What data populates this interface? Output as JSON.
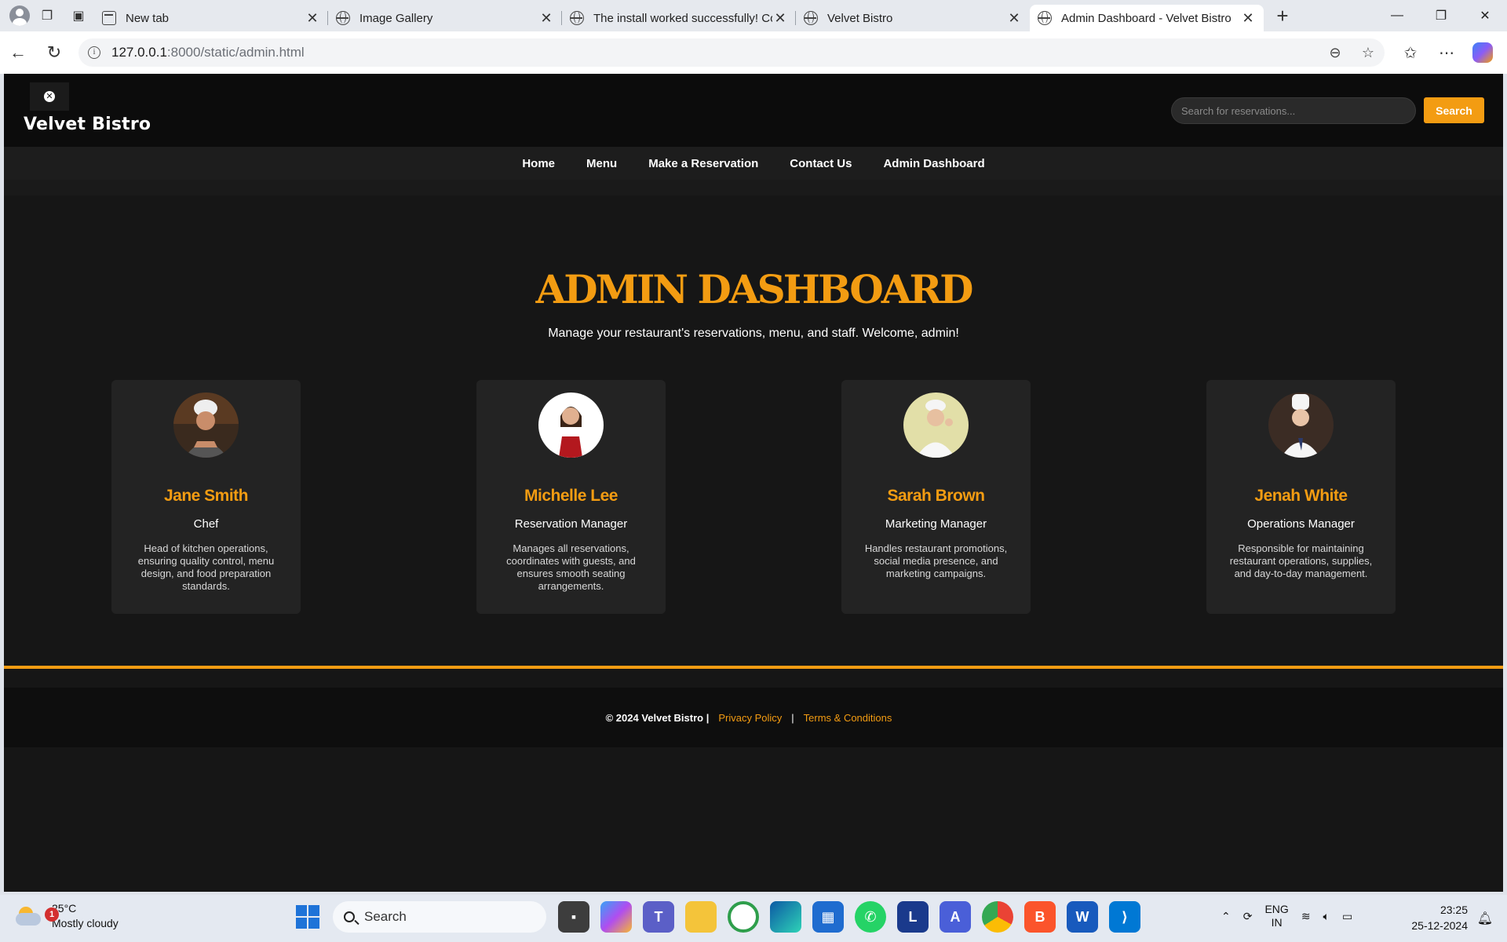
{
  "browser": {
    "tabs": [
      {
        "title": "New tab",
        "type": "newtab"
      },
      {
        "title": "Image Gallery",
        "type": "web"
      },
      {
        "title": "The install worked successfully! Co",
        "type": "web"
      },
      {
        "title": "Velvet Bistro",
        "type": "web"
      },
      {
        "title": "Admin Dashboard - Velvet Bistro",
        "type": "web",
        "active": true
      }
    ],
    "url_host": "127.0.0.1",
    "url_rest": ":8000/static/admin.html"
  },
  "site": {
    "brand": "Velvet Bistro",
    "search_placeholder": "Search for reservations...",
    "search_button": "Search",
    "nav": [
      "Home",
      "Menu",
      "Make a Reservation",
      "Contact Us",
      "Admin Dashboard"
    ],
    "hero_title": "ADMIN DASHBOARD",
    "hero_subtitle": "Manage your restaurant's reservations, menu, and staff. Welcome, admin!",
    "staff": [
      {
        "name": "Jane Smith",
        "role": "Chef",
        "desc": "Head of kitchen operations, ensuring quality control, menu design, and food preparation standards."
      },
      {
        "name": "Michelle Lee",
        "role": "Reservation Manager",
        "desc": "Manages all reservations, coordinates with guests, and ensures smooth seating arrangements."
      },
      {
        "name": "Sarah Brown",
        "role": "Marketing Manager",
        "desc": "Handles restaurant promotions, social media presence, and marketing campaigns."
      },
      {
        "name": "Jenah White",
        "role": "Operations Manager",
        "desc": "Responsible for maintaining restaurant operations, supplies, and day-to-day management."
      }
    ],
    "footer": {
      "copyright": "© 2024 Velvet Bistro |",
      "privacy": "Privacy Policy",
      "separator": "|",
      "terms": "Terms & Conditions"
    },
    "colors": {
      "accent": "#f39c12",
      "background": "#161616"
    }
  },
  "taskbar": {
    "weather_temp": "25°C",
    "weather_desc": "Mostly cloudy",
    "weather_badge": "1",
    "search_label": "Search",
    "lang_1": "ENG",
    "lang_2": "IN",
    "time": "23:25",
    "date": "25-12-2024"
  }
}
